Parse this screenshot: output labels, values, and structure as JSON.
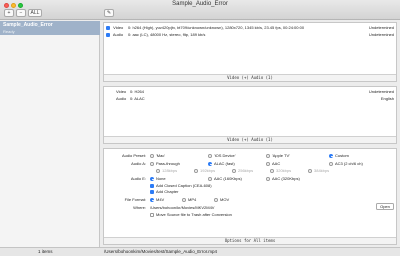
{
  "window": {
    "title": "Sample_Audio_Error"
  },
  "toolbar": {
    "add_label": "+",
    "remove_label": "−",
    "all_label": "ALL",
    "edit_label": "✎"
  },
  "sidebar": {
    "item_title": "Sample_Audio_Error",
    "item_subtitle": "Ready"
  },
  "tracks": [
    {
      "kind": "Video",
      "desc": "0: h264 (High), yuv420p(tv, bt709/unknown/unknown), 1280x720, 1345 kb/s, 23.45 fps, 00:24:00:00",
      "status": "Undetermined"
    },
    {
      "kind": "Audio",
      "desc": "0: aac (LC), 48000 Hz, stereo, fltp, 189 kb/s",
      "status": "Undetermined"
    }
  ],
  "panel1_footer": "Video (+) Audio (1)",
  "output_tracks": [
    {
      "kind": "Video",
      "desc": "0: H264",
      "status": "Undetermined"
    },
    {
      "kind": "Audio",
      "desc": "0: ALAC",
      "status": "English"
    }
  ],
  "panel2_footer": "Video (+) Audio (1)",
  "options": {
    "audio_preset_label": "Audio Preset:",
    "presets": [
      "'Mac'",
      "'iOS Device'",
      "'Apple TV'",
      "Custom"
    ],
    "audio_a_label": "Audio A:",
    "audio_a": [
      "Pass-through",
      "ALAC (fast)",
      "AAC",
      "AC3 (2 ch/6 ch)"
    ],
    "bitrates": [
      "128kbps",
      "192kbps",
      "256kbps",
      "320kbps",
      "384kbps"
    ],
    "audio_e_label": "Audio E:",
    "audio_e": [
      "None",
      "AAC (160Kbps)",
      "AAC (320Kbps)"
    ],
    "closed_caption": "Add Closed Caption (CEA-608)",
    "chapter": "Add Chapter",
    "file_format_label": "File Format:",
    "formats": [
      "M4V",
      "MP4",
      "MOV"
    ],
    "where_label": "Where:",
    "where_path": "/Users/bohoon/kr/Movies/MKV2M4V",
    "open_label": "Open",
    "trash_label": "Move Source file to Trash after Conversion",
    "footer": "Options for All items"
  },
  "status": {
    "count": "1 items",
    "path": "/Users/bohoonkim/Movies/test/Sample_Audio_Error.mp4"
  }
}
